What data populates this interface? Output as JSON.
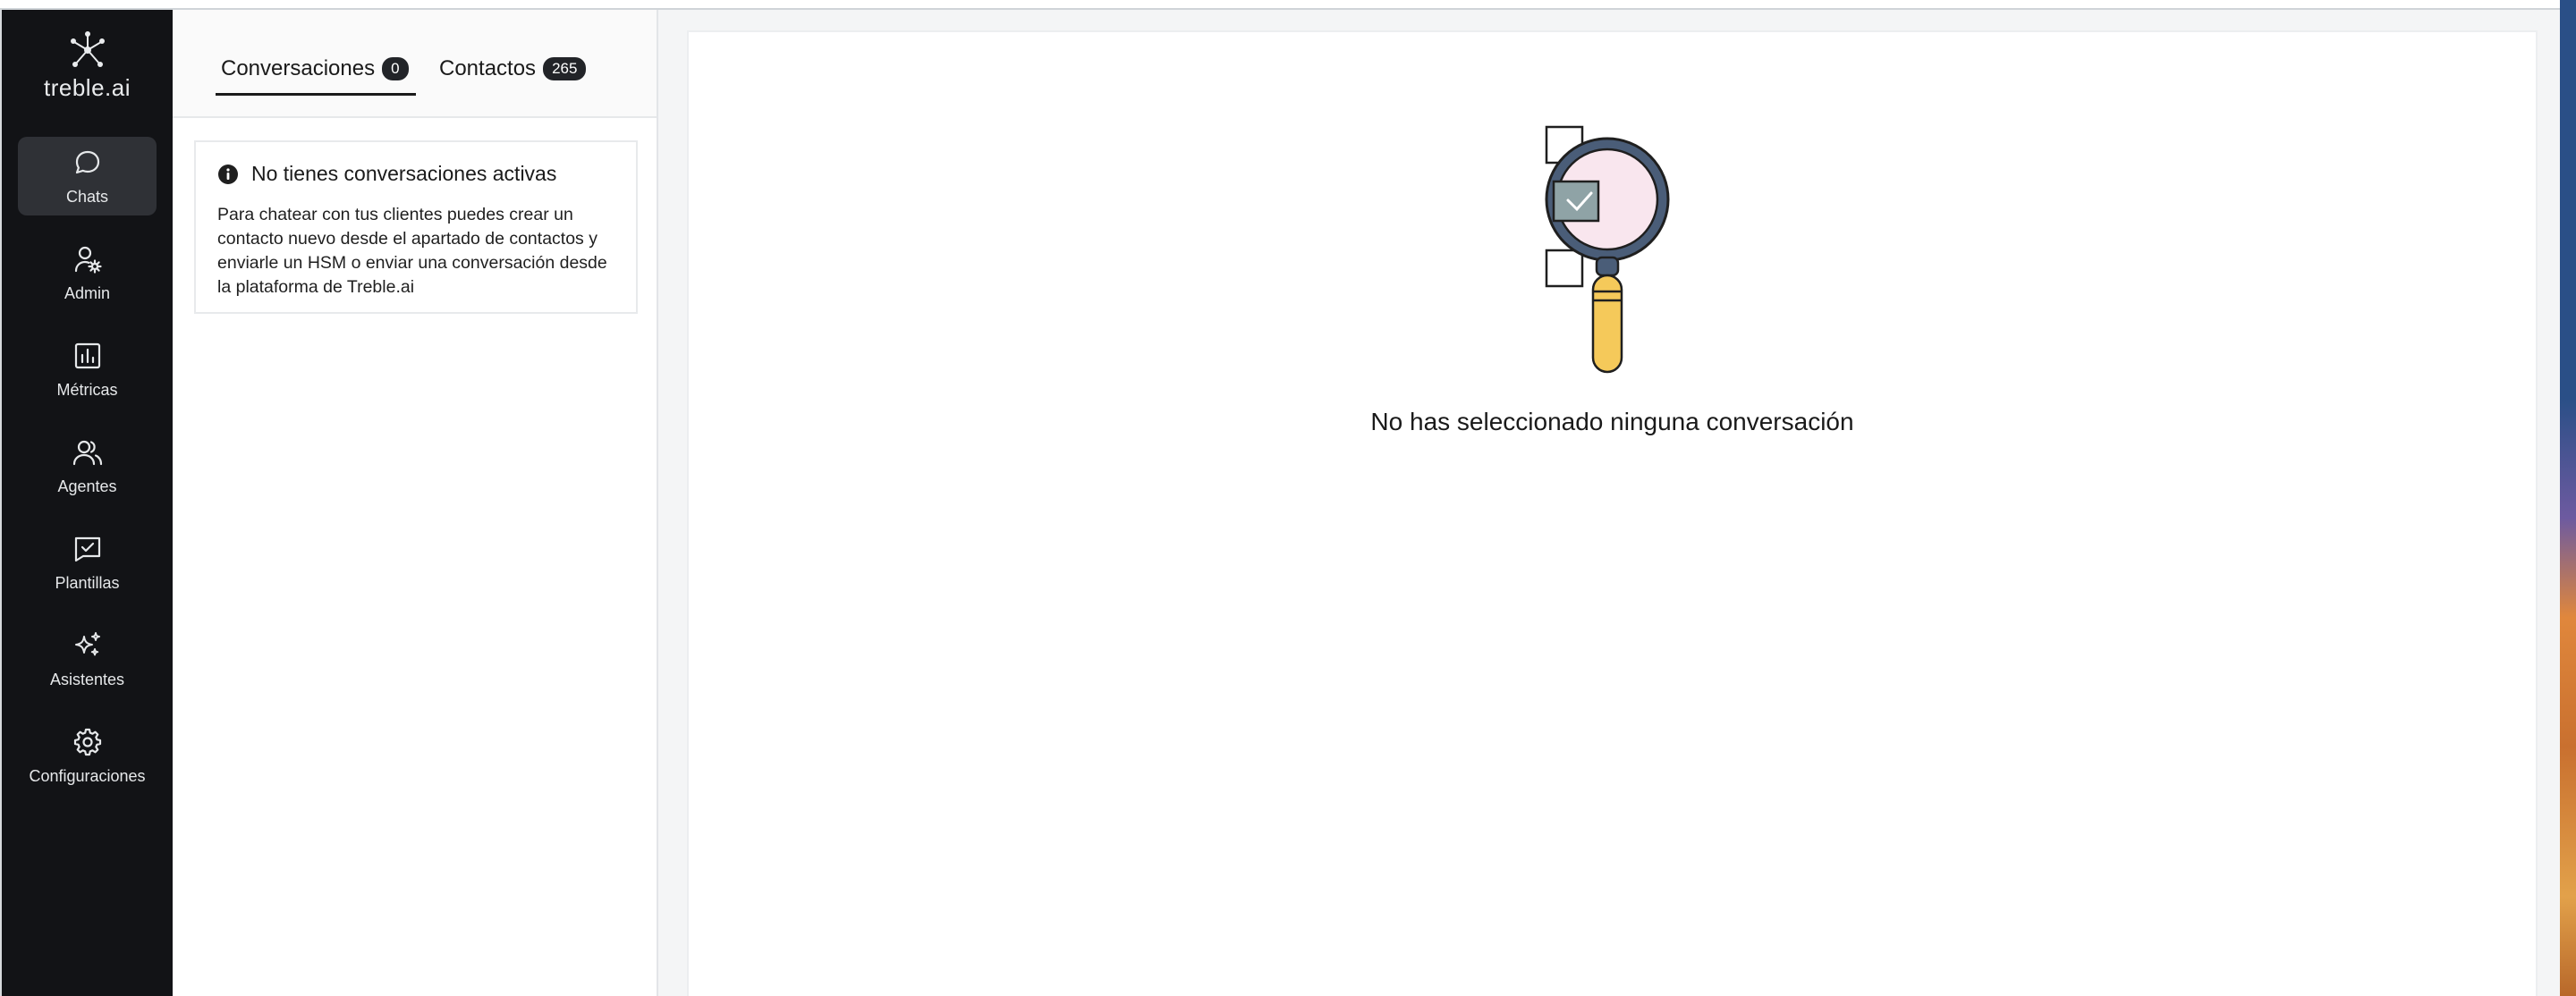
{
  "brand": {
    "name": "treble.ai"
  },
  "sidebar": {
    "items": [
      {
        "label": "Chats",
        "icon": "chat-bubble-icon",
        "active": true
      },
      {
        "label": "Admin",
        "icon": "user-gear-icon",
        "active": false
      },
      {
        "label": "Métricas",
        "icon": "bar-chart-icon",
        "active": false
      },
      {
        "label": "Agentes",
        "icon": "users-icon",
        "active": false
      },
      {
        "label": "Plantillas",
        "icon": "message-check-icon",
        "active": false
      },
      {
        "label": "Asistentes",
        "icon": "sparkles-icon",
        "active": false
      },
      {
        "label": "Configuraciones",
        "icon": "gear-icon",
        "active": false
      }
    ]
  },
  "tabs": [
    {
      "label": "Conversaciones",
      "count": "0",
      "active": true
    },
    {
      "label": "Contactos",
      "count": "265",
      "active": false
    }
  ],
  "info_card": {
    "icon": "info-icon",
    "title": "No tienes conversaciones activas",
    "body": "Para chatear con tus clientes puedes crear un contacto nuevo desde el apartado de contactos y enviarle un HSM o enviar una conversación desde la plataforma de Treble.ai"
  },
  "main": {
    "illustration": "magnifying-glass-icon",
    "empty_message": "No has seleccionado ninguna conversación"
  },
  "colors": {
    "sidebar_bg": "#121316",
    "active_item_bg": "#2f3136",
    "badge_bg": "#222428",
    "magnifier_handle": "#f5c95a",
    "magnifier_lens": "#f9e6ee"
  }
}
